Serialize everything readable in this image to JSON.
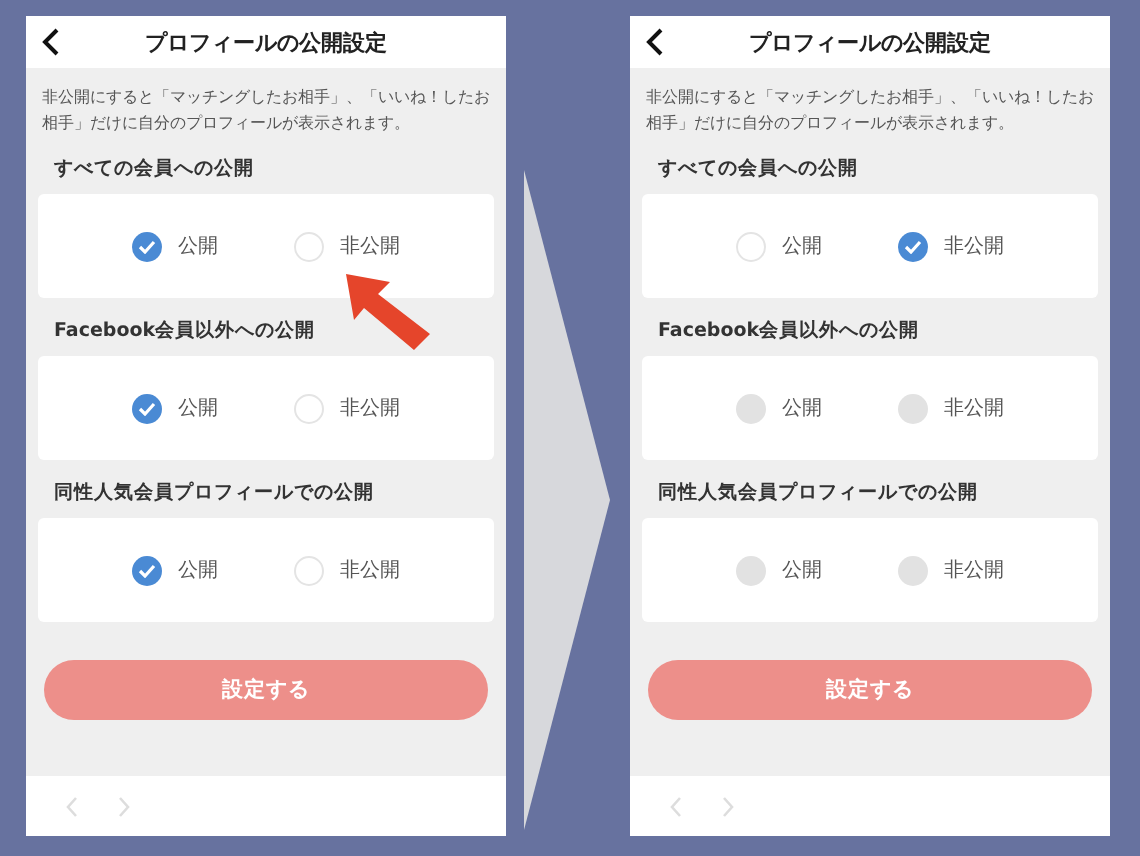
{
  "screens": [
    {
      "title": "プロフィールの公開設定",
      "description": "非公開にすると「マッチングしたお相手」、「いいね！したお相手」だけに自分のプロフィールが表示されます。",
      "pointer_arrow": true,
      "sections": [
        {
          "heading": "すべての会員への公開",
          "disabled": false,
          "options": [
            {
              "label": "公開",
              "selected": true
            },
            {
              "label": "非公開",
              "selected": false
            }
          ]
        },
        {
          "heading": "Facebook会員以外への公開",
          "disabled": false,
          "options": [
            {
              "label": "公開",
              "selected": true
            },
            {
              "label": "非公開",
              "selected": false
            }
          ]
        },
        {
          "heading": "同性人気会員プロフィールでの公開",
          "disabled": false,
          "options": [
            {
              "label": "公開",
              "selected": true
            },
            {
              "label": "非公開",
              "selected": false
            }
          ]
        }
      ],
      "button": "設定する"
    },
    {
      "title": "プロフィールの公開設定",
      "description": "非公開にすると「マッチングしたお相手」、「いいね！したお相手」だけに自分のプロフィールが表示されます。",
      "pointer_arrow": false,
      "sections": [
        {
          "heading": "すべての会員への公開",
          "disabled": false,
          "options": [
            {
              "label": "公開",
              "selected": false
            },
            {
              "label": "非公開",
              "selected": true
            }
          ]
        },
        {
          "heading": "Facebook会員以外への公開",
          "disabled": true,
          "options": [
            {
              "label": "公開",
              "selected": false
            },
            {
              "label": "非公開",
              "selected": false
            }
          ]
        },
        {
          "heading": "同性人気会員プロフィールでの公開",
          "disabled": true,
          "options": [
            {
              "label": "公開",
              "selected": false
            },
            {
              "label": "非公開",
              "selected": false
            }
          ]
        }
      ],
      "button": "設定する"
    }
  ]
}
